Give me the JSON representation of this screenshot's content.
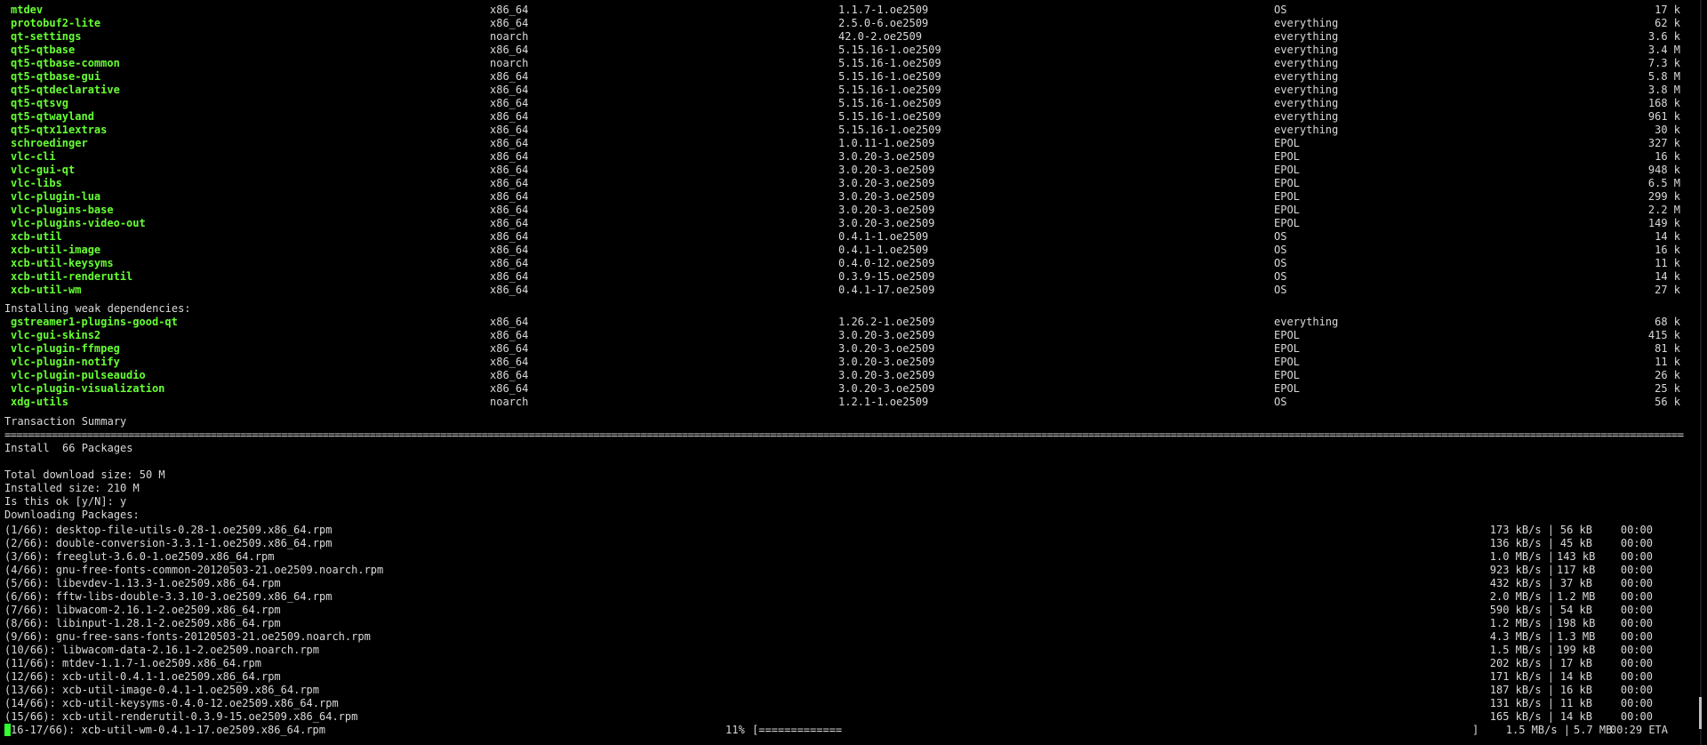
{
  "colors": {
    "background": "#000000",
    "text": "#d9d9d9",
    "package_name": "#66ff33",
    "cursor": "#33ff33"
  },
  "packages_main": [
    {
      "name": "mtdev",
      "arch": "x86_64",
      "version": "1.1.7-1.oe2509",
      "repo": "OS",
      "size": "17 k"
    },
    {
      "name": "protobuf2-lite",
      "arch": "x86_64",
      "version": "2.5.0-6.oe2509",
      "repo": "everything",
      "size": "62 k"
    },
    {
      "name": "qt-settings",
      "arch": "noarch",
      "version": "42.0-2.oe2509",
      "repo": "everything",
      "size": "3.6 k"
    },
    {
      "name": "qt5-qtbase",
      "arch": "x86_64",
      "version": "5.15.16-1.oe2509",
      "repo": "everything",
      "size": "3.4 M"
    },
    {
      "name": "qt5-qtbase-common",
      "arch": "noarch",
      "version": "5.15.16-1.oe2509",
      "repo": "everything",
      "size": "7.3 k"
    },
    {
      "name": "qt5-qtbase-gui",
      "arch": "x86_64",
      "version": "5.15.16-1.oe2509",
      "repo": "everything",
      "size": "5.8 M"
    },
    {
      "name": "qt5-qtdeclarative",
      "arch": "x86_64",
      "version": "5.15.16-1.oe2509",
      "repo": "everything",
      "size": "3.8 M"
    },
    {
      "name": "qt5-qtsvg",
      "arch": "x86_64",
      "version": "5.15.16-1.oe2509",
      "repo": "everything",
      "size": "168 k"
    },
    {
      "name": "qt5-qtwayland",
      "arch": "x86_64",
      "version": "5.15.16-1.oe2509",
      "repo": "everything",
      "size": "961 k"
    },
    {
      "name": "qt5-qtx11extras",
      "arch": "x86_64",
      "version": "5.15.16-1.oe2509",
      "repo": "everything",
      "size": "30 k"
    },
    {
      "name": "schroedinger",
      "arch": "x86_64",
      "version": "1.0.11-1.oe2509",
      "repo": "EPOL",
      "size": "327 k"
    },
    {
      "name": "vlc-cli",
      "arch": "x86_64",
      "version": "3.0.20-3.oe2509",
      "repo": "EPOL",
      "size": "16 k"
    },
    {
      "name": "vlc-gui-qt",
      "arch": "x86_64",
      "version": "3.0.20-3.oe2509",
      "repo": "EPOL",
      "size": "948 k"
    },
    {
      "name": "vlc-libs",
      "arch": "x86_64",
      "version": "3.0.20-3.oe2509",
      "repo": "EPOL",
      "size": "6.5 M"
    },
    {
      "name": "vlc-plugin-lua",
      "arch": "x86_64",
      "version": "3.0.20-3.oe2509",
      "repo": "EPOL",
      "size": "299 k"
    },
    {
      "name": "vlc-plugins-base",
      "arch": "x86_64",
      "version": "3.0.20-3.oe2509",
      "repo": "EPOL",
      "size": "2.2 M"
    },
    {
      "name": "vlc-plugins-video-out",
      "arch": "x86_64",
      "version": "3.0.20-3.oe2509",
      "repo": "EPOL",
      "size": "149 k"
    },
    {
      "name": "xcb-util",
      "arch": "x86_64",
      "version": "0.4.1-1.oe2509",
      "repo": "OS",
      "size": "14 k"
    },
    {
      "name": "xcb-util-image",
      "arch": "x86_64",
      "version": "0.4.1-1.oe2509",
      "repo": "OS",
      "size": "16 k"
    },
    {
      "name": "xcb-util-keysyms",
      "arch": "x86_64",
      "version": "0.4.0-12.oe2509",
      "repo": "OS",
      "size": "11 k"
    },
    {
      "name": "xcb-util-renderutil",
      "arch": "x86_64",
      "version": "0.3.9-15.oe2509",
      "repo": "OS",
      "size": "14 k"
    },
    {
      "name": "xcb-util-wm",
      "arch": "x86_64",
      "version": "0.4.1-17.oe2509",
      "repo": "OS",
      "size": "27 k"
    }
  ],
  "weak_deps_heading": "Installing weak dependencies:",
  "packages_weak": [
    {
      "name": "gstreamer1-plugins-good-qt",
      "arch": "x86_64",
      "version": "1.26.2-1.oe2509",
      "repo": "everything",
      "size": "68 k"
    },
    {
      "name": "vlc-gui-skins2",
      "arch": "x86_64",
      "version": "3.0.20-3.oe2509",
      "repo": "EPOL",
      "size": "415 k"
    },
    {
      "name": "vlc-plugin-ffmpeg",
      "arch": "x86_64",
      "version": "3.0.20-3.oe2509",
      "repo": "EPOL",
      "size": "81 k"
    },
    {
      "name": "vlc-plugin-notify",
      "arch": "x86_64",
      "version": "3.0.20-3.oe2509",
      "repo": "EPOL",
      "size": "11 k"
    },
    {
      "name": "vlc-plugin-pulseaudio",
      "arch": "x86_64",
      "version": "3.0.20-3.oe2509",
      "repo": "EPOL",
      "size": "26 k"
    },
    {
      "name": "vlc-plugin-visualization",
      "arch": "x86_64",
      "version": "3.0.20-3.oe2509",
      "repo": "EPOL",
      "size": "25 k"
    },
    {
      "name": "xdg-utils",
      "arch": "noarch",
      "version": "1.2.1-1.oe2509",
      "repo": "OS",
      "size": "56 k"
    }
  ],
  "summary": {
    "heading": "Transaction Summary",
    "install_line": "Install  66 Packages",
    "download_size": "Total download size: 50 M",
    "installed_size": "Installed size: 210 M",
    "prompt": "Is this ok [y/N]: y",
    "downloading": "Downloading Packages:"
  },
  "downloads": [
    {
      "file": "(1/66): desktop-file-utils-0.28-1.oe2509.x86_64.rpm",
      "speed": "173 kB/s |",
      "size": "56 kB",
      "time": "00:00"
    },
    {
      "file": "(2/66): double-conversion-3.3.1-1.oe2509.x86_64.rpm",
      "speed": "136 kB/s |",
      "size": "45 kB",
      "time": "00:00"
    },
    {
      "file": "(3/66): freeglut-3.6.0-1.oe2509.x86_64.rpm",
      "speed": "1.0 MB/s |",
      "size": "143 kB",
      "time": "00:00"
    },
    {
      "file": "(4/66): gnu-free-fonts-common-20120503-21.oe2509.noarch.rpm",
      "speed": "923 kB/s |",
      "size": "117 kB",
      "time": "00:00"
    },
    {
      "file": "(5/66): libevdev-1.13.3-1.oe2509.x86_64.rpm",
      "speed": "432 kB/s |",
      "size": "37 kB",
      "time": "00:00"
    },
    {
      "file": "(6/66): fftw-libs-double-3.3.10-3.oe2509.x86_64.rpm",
      "speed": "2.0 MB/s |",
      "size": "1.2 MB",
      "time": "00:00"
    },
    {
      "file": "(7/66): libwacom-2.16.1-2.oe2509.x86_64.rpm",
      "speed": "590 kB/s |",
      "size": "54 kB",
      "time": "00:00"
    },
    {
      "file": "(8/66): libinput-1.28.1-2.oe2509.x86_64.rpm",
      "speed": "1.2 MB/s |",
      "size": "198 kB",
      "time": "00:00"
    },
    {
      "file": "(9/66): gnu-free-sans-fonts-20120503-21.oe2509.noarch.rpm",
      "speed": "4.3 MB/s |",
      "size": "1.3 MB",
      "time": "00:00"
    },
    {
      "file": "(10/66): libwacom-data-2.16.1-2.oe2509.noarch.rpm",
      "speed": "1.5 MB/s |",
      "size": "199 kB",
      "time": "00:00"
    },
    {
      "file": "(11/66): mtdev-1.1.7-1.oe2509.x86_64.rpm",
      "speed": "202 kB/s |",
      "size": "17 kB",
      "time": "00:00"
    },
    {
      "file": "(12/66): xcb-util-0.4.1-1.oe2509.x86_64.rpm",
      "speed": "171 kB/s |",
      "size": "14 kB",
      "time": "00:00"
    },
    {
      "file": "(13/66): xcb-util-image-0.4.1-1.oe2509.x86_64.rpm",
      "speed": "187 kB/s |",
      "size": "16 kB",
      "time": "00:00"
    },
    {
      "file": "(14/66): xcb-util-keysyms-0.4.0-12.oe2509.x86_64.rpm",
      "speed": "131 kB/s |",
      "size": "11 kB",
      "time": "00:00"
    },
    {
      "file": "(15/66): xcb-util-renderutil-0.3.9-15.oe2509.x86_64.rpm",
      "speed": "165 kB/s |",
      "size": "14 kB",
      "time": "00:00"
    }
  ],
  "progress": {
    "file": "16-17/66): xcb-util-wm-0.4.1-17.oe2509.x86_64.rpm",
    "percent": "11%",
    "bar": "[=============",
    "bar_end": "]",
    "speed": "1.5 MB/s |",
    "size": "5.7 MB",
    "eta": "00:29 ETA"
  }
}
